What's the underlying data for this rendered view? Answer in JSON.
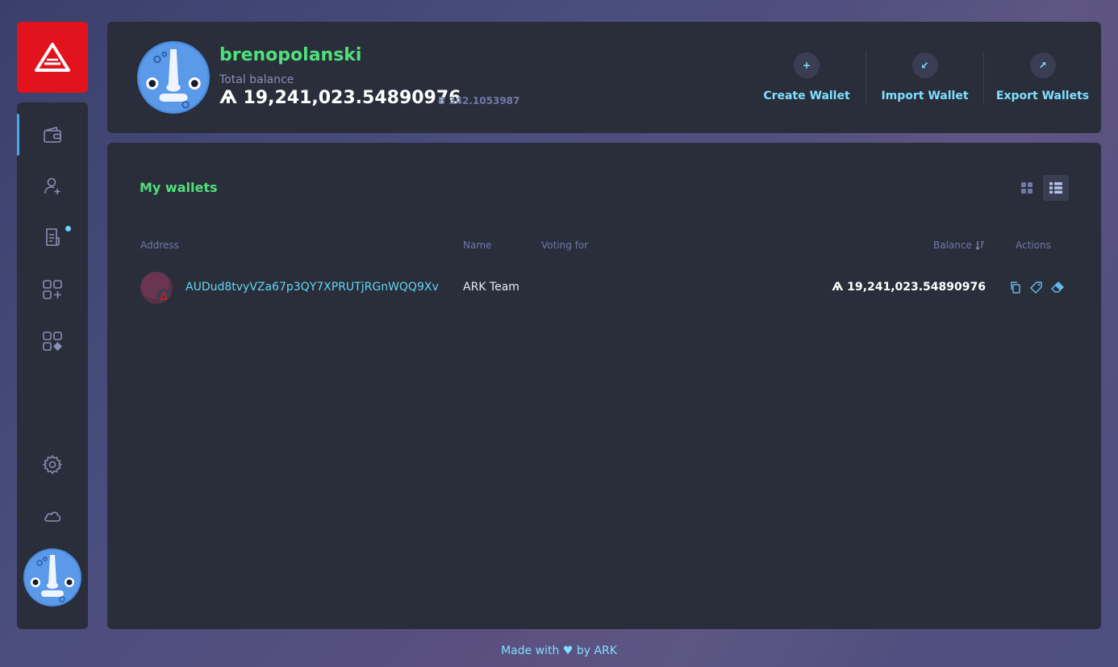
{
  "colors": {
    "brand_red": "#e3131d",
    "accent_green": "#4fe07a",
    "accent_cyan": "#7ee0ff",
    "panel": "#2a2d3a"
  },
  "sidebar": {
    "items": [
      {
        "icon": "wallet-icon",
        "active": true
      },
      {
        "icon": "add-contact-icon"
      },
      {
        "icon": "announcements-icon",
        "badge": true
      },
      {
        "icon": "plugins-icon"
      },
      {
        "icon": "plugin-manager-icon"
      },
      {
        "icon": "gear-icon"
      },
      {
        "icon": "cloud-icon"
      }
    ]
  },
  "header": {
    "profile_name": "brenopolanski",
    "balance_label": "Total balance",
    "balance": "Ѧ 19,241,023.54890976",
    "balance_alt": "Ƀ 342.1053987",
    "actions": [
      {
        "label": "Create Wallet",
        "glyph": "+"
      },
      {
        "label": "Import Wallet",
        "glyph": "↙"
      },
      {
        "label": "Export Wallets",
        "glyph": "↗"
      }
    ]
  },
  "main": {
    "title": "My wallets",
    "columns": {
      "address": "Address",
      "name": "Name",
      "voting_for": "Voting for",
      "balance": "Balance",
      "actions": "Actions"
    },
    "rows": [
      {
        "address": "AUDud8tvyVZa67p3QY7XPRUTjRGnWQQ9Xv",
        "name": "ARK Team",
        "voting_for": "",
        "balance": "Ѧ 19,241,023.54890976"
      }
    ]
  },
  "footer": {
    "text": "Made with ♥ by ARK"
  }
}
